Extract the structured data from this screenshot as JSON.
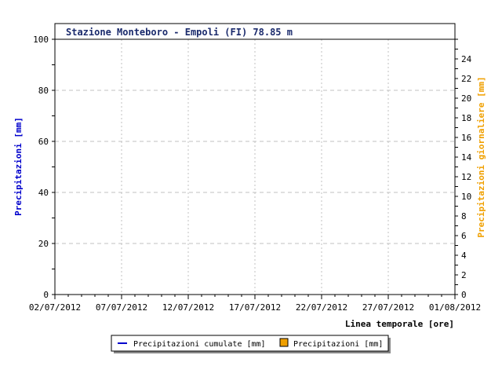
{
  "colors": {
    "background": "#ffffff",
    "axis": "#000000",
    "grid": "#c0c0c0",
    "title_text": "#1a2a6c",
    "left_axis_label": "#0000cc",
    "right_axis_label": "#f0a000",
    "series_cumulative": "#0000cc",
    "series_daily": "#f0a000",
    "legend_shadow": "#888888"
  },
  "chart_data": {
    "type": "bar",
    "title": "Stazione Monteboro - Empoli (FI) 78.85 m",
    "xlabel": "Linea temporale [ore]",
    "ylabel_left": "Precipitazioni [mm]",
    "ylabel_right": "Precipitazioni giornaliere [mm]",
    "x_range": [
      "02/07/2012",
      "01/08/2012"
    ],
    "x_ticks": [
      "02/07/2012",
      "07/07/2012",
      "12/07/2012",
      "17/07/2012",
      "22/07/2012",
      "27/07/2012",
      "01/08/2012"
    ],
    "ylim_left": [
      0,
      100
    ],
    "y_ticks_left": [
      "0",
      "20",
      "40",
      "60",
      "80",
      "100"
    ],
    "ylim_right": [
      0,
      26
    ],
    "y_ticks_right": [
      "0",
      "2",
      "4",
      "6",
      "8",
      "10",
      "12",
      "14",
      "16",
      "18",
      "20",
      "22",
      "24"
    ],
    "grid": true,
    "legend_position": "bottom-center",
    "series": [
      {
        "name": "Precipitazioni cumulate [mm]",
        "kind": "line",
        "axis": "left",
        "values": []
      },
      {
        "name": "Precipitazioni [mm]",
        "kind": "bar",
        "axis": "right",
        "values": []
      }
    ]
  }
}
